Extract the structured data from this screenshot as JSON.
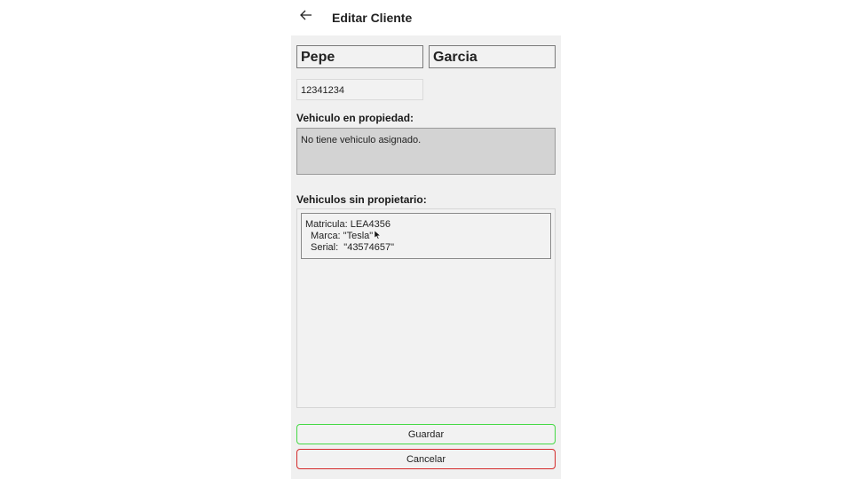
{
  "header": {
    "title": "Editar Cliente",
    "back_icon": "arrow-left-icon"
  },
  "client": {
    "first_name": "Pepe",
    "last_name": "Garcia",
    "id_number": "12341234"
  },
  "owned_section": {
    "label": "Vehiculo en propiedad:",
    "empty_text": "No tiene vehiculo asignado."
  },
  "free_section": {
    "label": "Vehiculos sin propietario:",
    "vehicles": [
      {
        "plate_line": "Matricula: LEA4356",
        "brand_line": "Marca: \"Tesla\"",
        "serial_line": "Serial:  \"43574657\""
      }
    ]
  },
  "actions": {
    "save_label": "Guardar",
    "cancel_label": "Cancelar",
    "save_color": "#44d944",
    "cancel_color": "#d42a2a"
  }
}
